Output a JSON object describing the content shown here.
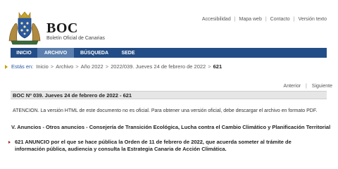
{
  "top_links": [
    "Accesibilidad",
    "Mapa web",
    "Contacto",
    "Versión texto"
  ],
  "brand": {
    "name": "BOC",
    "subtitle": "Boletín Oficial de Canarias"
  },
  "nav": [
    {
      "label": "INICIO",
      "active": false
    },
    {
      "label": "ARCHIVO",
      "active": true
    },
    {
      "label": "BÚSQUEDA",
      "active": false
    },
    {
      "label": "SEDE",
      "active": false
    }
  ],
  "breadcrumb": {
    "lead": "Estás en:",
    "items": [
      "Inicio",
      "Archivo",
      "Año 2022",
      "2022/039. Jueves 24 de febrero de 2022"
    ],
    "current": "621"
  },
  "pager": {
    "prev": "Anterior",
    "next": "Siguiente"
  },
  "bulletin_title": "BOC Nº 039. Jueves 24 de febrero de 2022 - 621",
  "notice": "ATENCION. La versión HTML de este documento no es oficial. Para obtener una versión oficial, debe descargar el archivo en formato PDF.",
  "section": "V. Anuncios - Otros anuncios - Consejería de Transición Ecológica, Lucha contra el Cambio Climático y Planificación Territorial",
  "announcement": {
    "line1": "621 ANUNCIO por el que se hace pública la Orden de 11 de febrero de 2022, que acuerda someter al trámite de",
    "line2": "información pública, audiencia y consulta la Estrategia Canaria de Acción Climática."
  },
  "colors": {
    "nav_bg": "#234d86",
    "nav_active": "#5b7fae",
    "bar_bg": "#e6e6e6",
    "bullet": "#a01c2e"
  },
  "icons": [
    "coat-of-arms-logo",
    "breadcrumb-arrow-icon",
    "announcement-bullet-icon"
  ]
}
